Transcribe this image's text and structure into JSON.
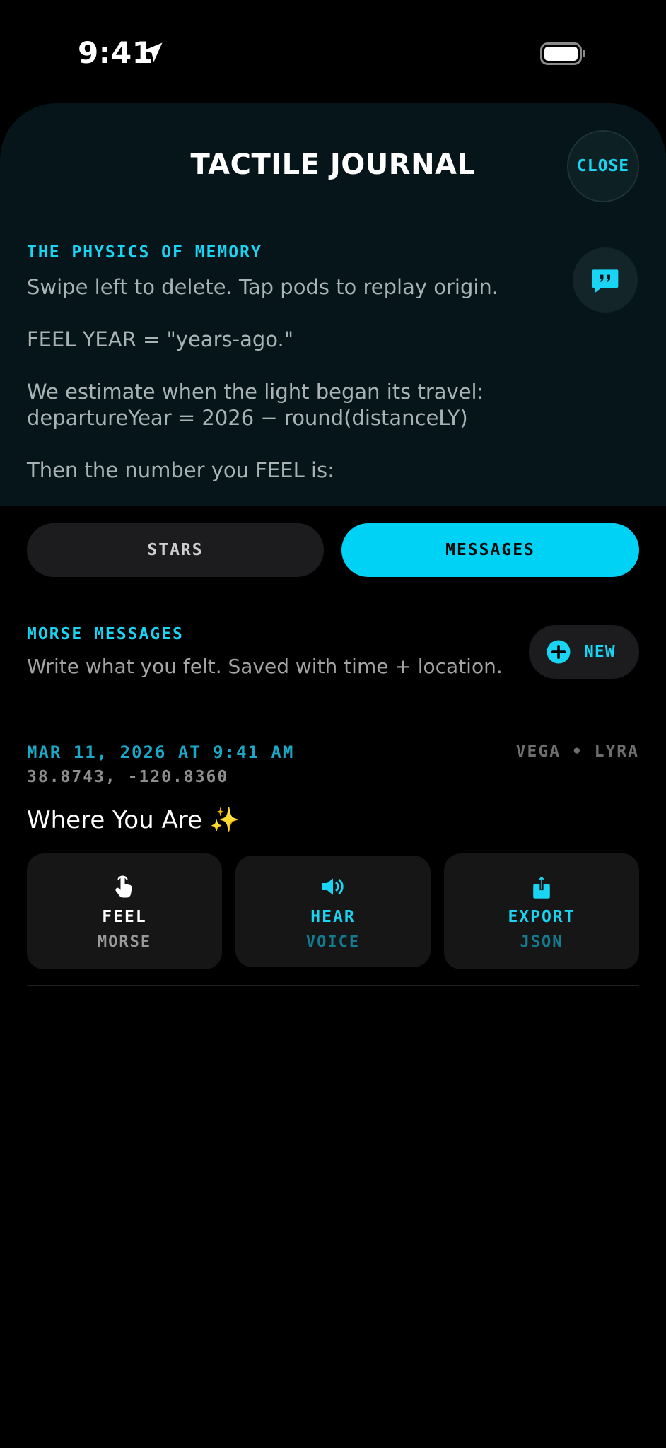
{
  "status_bar": {
    "time": "9:41",
    "icons": [
      "location-arrow-icon",
      "airplane-icon",
      "battery-icon"
    ]
  },
  "sheet": {
    "title": "TACTILE JOURNAL",
    "close_label": "CLOSE",
    "section_label": "THE PHYSICS OF MEMORY",
    "body": [
      "Swipe left to delete. Tap pods to replay origin.",
      "FEEL YEAR = \"years-ago.\"",
      "We estimate when the light began its travel:\ndepartureYear = 2026 − round(distanceLY)",
      "Then the number you FEEL is:"
    ]
  },
  "segments": {
    "stars": "STARS",
    "messages": "MESSAGES",
    "selected": "messages"
  },
  "morse": {
    "title": "MORSE MESSAGES",
    "subtitle": "Write what you felt. Saved with time + location.",
    "new_label": "NEW"
  },
  "entry": {
    "date": "MAR 11, 2026 AT 9:41 AM",
    "coords": "38.8743, -120.8360",
    "star": "VEGA • LYRA",
    "title": "Where You Are ✨",
    "actions": [
      {
        "label": "FEEL",
        "sub": "MORSE",
        "icon": "hand-tap-icon"
      },
      {
        "label": "HEAR",
        "sub": "VOICE",
        "icon": "speaker-icon"
      },
      {
        "label": "EXPORT",
        "sub": "JSON",
        "icon": "share-icon"
      }
    ]
  },
  "colors": {
    "accent": "#00d2f5",
    "sheet_bg": "#061519",
    "card_bg": "#161616"
  }
}
